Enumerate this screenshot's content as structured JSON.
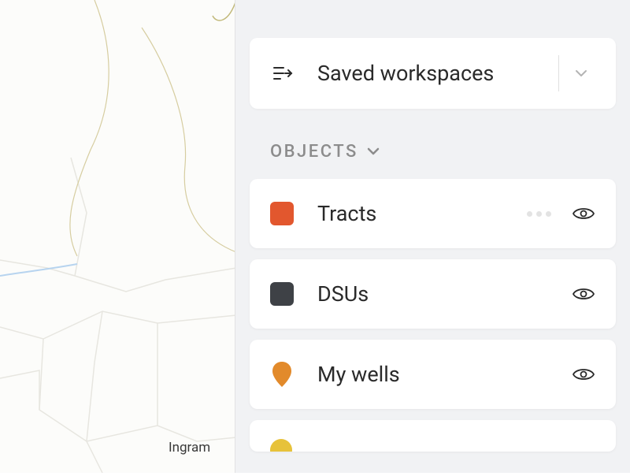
{
  "map": {
    "label_ingram": "Ingram"
  },
  "panel": {
    "workspace_selector_label": "Saved workspaces",
    "section_objects_label": "OBJECTS",
    "objects": [
      {
        "label": "Tracts",
        "swatch_color": "#e2572e",
        "shape": "square",
        "show_more": true
      },
      {
        "label": "DSUs",
        "swatch_color": "#3e4146",
        "shape": "square",
        "show_more": false
      },
      {
        "label": "My wells",
        "swatch_color": "#e28a2b",
        "shape": "pin",
        "show_more": false
      }
    ]
  }
}
